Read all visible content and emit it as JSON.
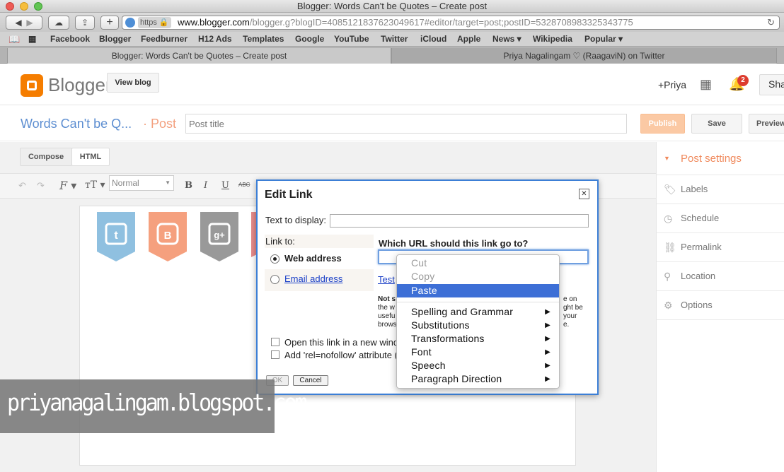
{
  "window": {
    "title": "Blogger: Words Can't be Quotes – Create post"
  },
  "toolbar": {
    "url_scheme": "https",
    "url_domain": "www.blogger.com",
    "url_path": "/blogger.g?blogID=4085121837623049617#editor/target=post;postID=5328708983325343775"
  },
  "bookmarks": [
    "Facebook",
    "Blogger",
    "Feedburner",
    "H12 Ads",
    "Templates",
    "Google",
    "YouTube",
    "Twitter",
    "iCloud",
    "Apple",
    "News ▾",
    "Wikipedia",
    "Popular ▾"
  ],
  "tabs": [
    {
      "label": "Blogger: Words Can't be Quotes – Create post"
    },
    {
      "label": "Priya Nagalingam ♡ (RaagaviN) on Twitter"
    }
  ],
  "header": {
    "logo_text": "Blogger",
    "view_blog": "View blog",
    "user": "+Priya",
    "notif_count": "2",
    "share": "Sha"
  },
  "postbar": {
    "blog_name": "Words Can't be Q...",
    "post_label": "· Post",
    "title_placeholder": "Post title",
    "publish": "Publish",
    "save": "Save",
    "preview": "Preview"
  },
  "editor": {
    "compose": "Compose",
    "html": "HTML",
    "format_select": "Normal"
  },
  "sidebar": {
    "heading": "Post settings",
    "items": [
      "Labels",
      "Schedule",
      "Permalink",
      "Location",
      "Options"
    ]
  },
  "dialog": {
    "title": "Edit Link",
    "close": "✕",
    "text_display_label": "Text to display:",
    "text_display_value": "",
    "link_to_label": "Link to:",
    "web_address": "Web address",
    "email_address": "Email address",
    "url_question": "Which URL should this link go to?",
    "url_value": "",
    "test_link": "Test",
    "note_bold": "Not s",
    "note_l2_start": "the w",
    "note_l3_start": "usefu",
    "note_l4_start": "brows",
    "note_l1_end": "e on",
    "note_l2_end": "ght be",
    "note_l3_end": "your",
    "note_l4_end": "e.",
    "open_new_window": "Open this link in a new wind",
    "nofollow": "Add 'rel=nofollow' attribute (",
    "ok": "OK",
    "cancel": "Cancel"
  },
  "context_menu": {
    "items": [
      {
        "label": "Cut",
        "enabled": false,
        "submenu": false
      },
      {
        "label": "Copy",
        "enabled": false,
        "submenu": false
      },
      {
        "label": "Paste",
        "enabled": true,
        "submenu": false,
        "highlighted": true
      },
      {
        "label": "Spelling and Grammar",
        "enabled": true,
        "submenu": true
      },
      {
        "label": "Substitutions",
        "enabled": true,
        "submenu": true
      },
      {
        "label": "Transformations",
        "enabled": true,
        "submenu": true
      },
      {
        "label": "Font",
        "enabled": true,
        "submenu": true
      },
      {
        "label": "Speech",
        "enabled": true,
        "submenu": true
      },
      {
        "label": "Paragraph Direction",
        "enabled": true,
        "submenu": true
      }
    ]
  },
  "watermark": {
    "text": "priyanagalingam.blogspot.com"
  },
  "colors": {
    "blogger_orange": "#f57d00",
    "accent_blue": "#3c7fd6",
    "menu_highlight": "#3d6fd6",
    "publish_bg": "#fbc9a4",
    "twitter_badge": "#8fc0e0",
    "blogger_badge": "#f5a07e",
    "gplus_badge": "#999999"
  }
}
